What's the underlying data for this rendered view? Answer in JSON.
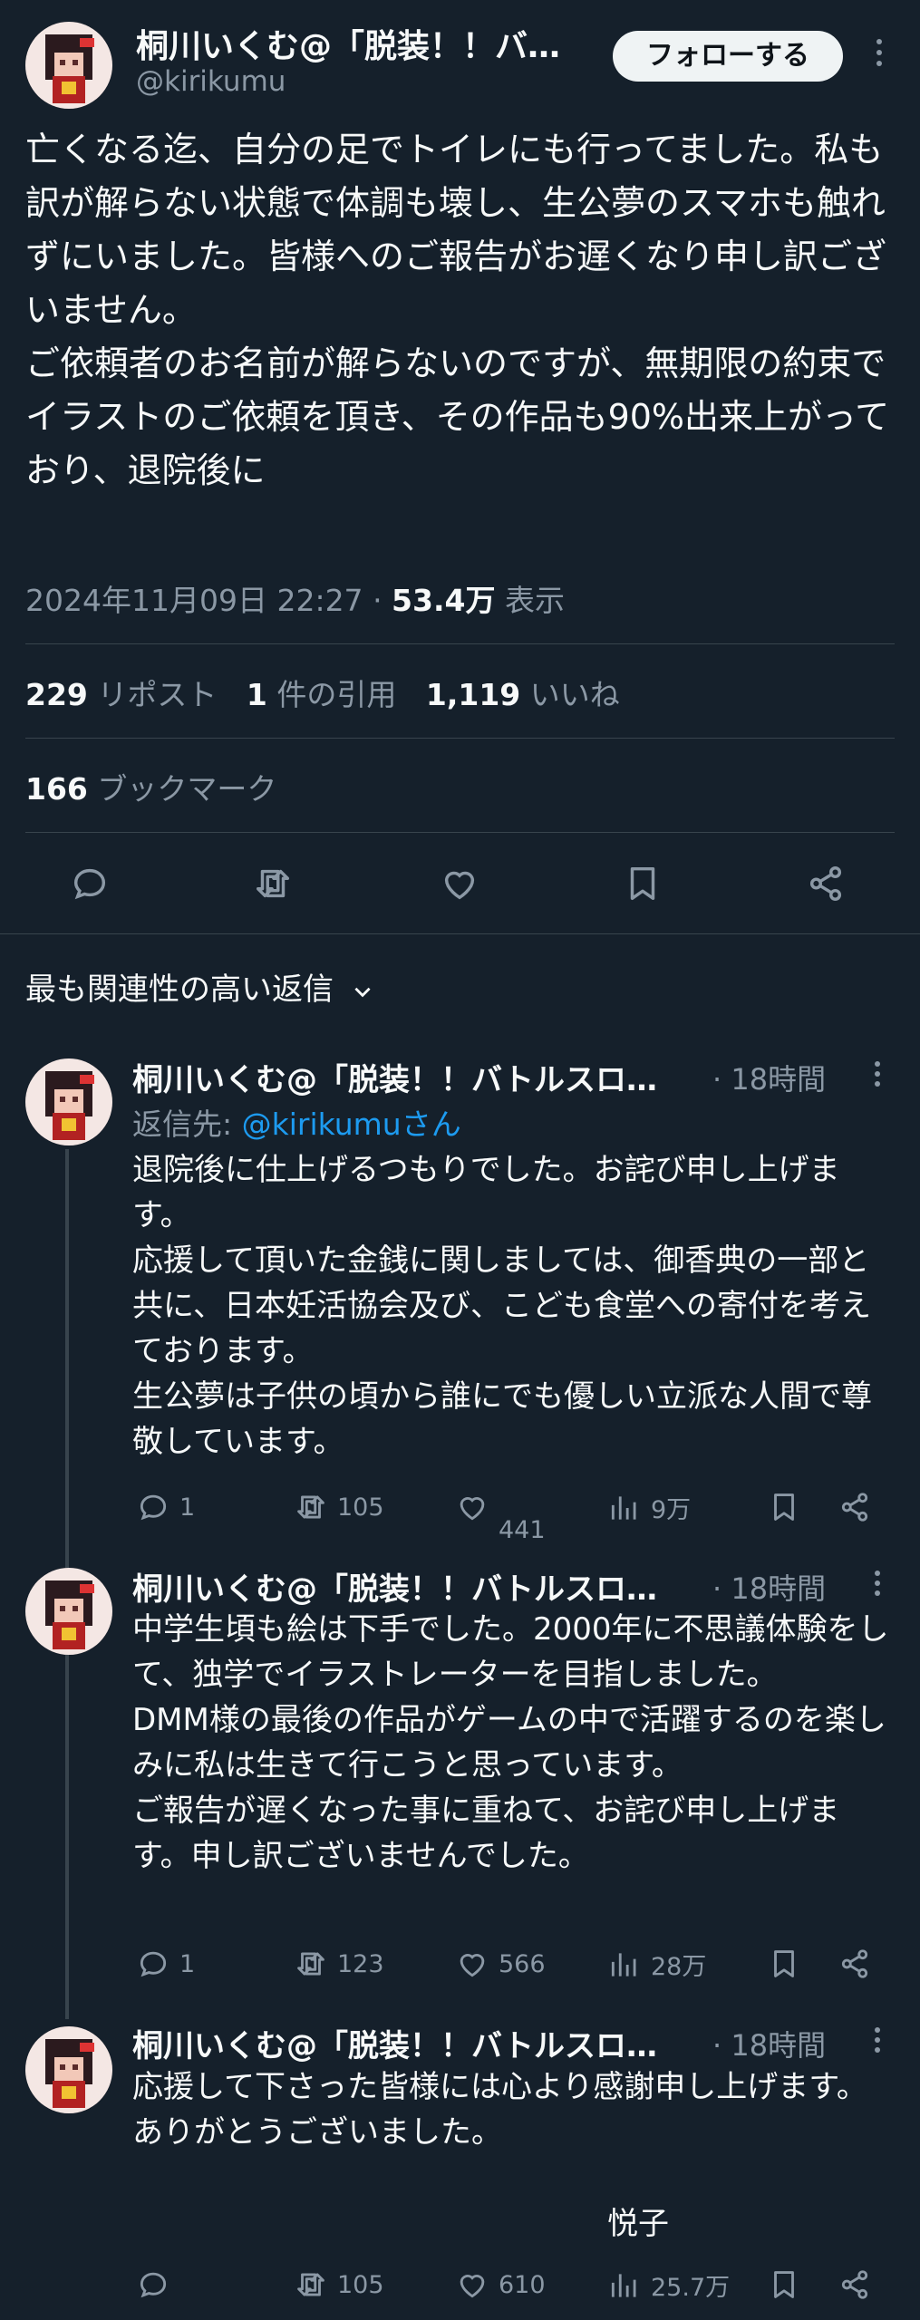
{
  "main": {
    "author_name": "桐川いくむ@「脱装！！バ…",
    "author_handle": "@kirikumu",
    "follow_label": "フォローする",
    "text": "亡くなる迄、自分の足でトイレにも行ってました。私も訳が解らない状態で体調も壊し、生公夢のスマホも触れずにいました。皆様へのご報告がお遅くなり申し訳ございません。\nご依頼者のお名前が解らないのですが、無期限の約束でイラストのご依頼を頂き、その作品も90%出来上がっており、退院後に",
    "timestamp": "2024年11月09日 22:27",
    "views_count": "53.4万",
    "views_label": "表示",
    "reposts_count": "229",
    "reposts_label": "リポスト",
    "quotes_count": "1",
    "quotes_label": "件の引用",
    "likes_count": "1,119",
    "likes_label": "いいね",
    "bookmarks_count": "166",
    "bookmarks_label": "ブックマーク"
  },
  "sort_label": "最も関連性の高い返信",
  "replies": [
    {
      "author_name": "桐川いくむ@「脱装！！バトルスロ…",
      "time": "· 18時間",
      "reply_to_label": "返信先:",
      "reply_to_handle": "@kirikumuさん",
      "text": "退院後に仕上げるつもりでした。お詫び申し上げます。\n応援して頂いた金銭に関しましては、御香典の一部と共に、日本妊活協会及び、こども食堂への寄付を考えております。\n生公夢は子供の頃から誰にでも優しい立派な人間で尊敬しています。",
      "replies": "1",
      "reposts": "105",
      "likes": "441",
      "views": "9万"
    },
    {
      "author_name": "桐川いくむ@「脱装！！バトルスロ…",
      "time": "· 18時間",
      "text": "中学生頃も絵は下手でした。2000年に不思議体験をして、独学でイラストレーターを目指しました。\nDMM様の最後の作品がゲームの中で活躍するのを楽しみに私は生きて行こうと思っています。\nご報告が遅くなった事に重ねて、お詫び申し上げます。申し訳ございませんでした。",
      "replies": "1",
      "reposts": "123",
      "likes": "566",
      "views": "28万"
    },
    {
      "author_name": "桐川いくむ@「脱装！！バトルスロ…",
      "time": "· 18時間",
      "text": "応援して下さった皆様には心より感謝申し上げます。\nありがとうございました。",
      "signature": "悦子",
      "replies": "",
      "reposts": "105",
      "likes": "610",
      "views": "25.7万"
    }
  ],
  "colors": {
    "background": "#15202b",
    "text": "#f7f9f9",
    "muted": "#8b98a5",
    "divider": "#38444d",
    "link": "#1d9bf0"
  }
}
